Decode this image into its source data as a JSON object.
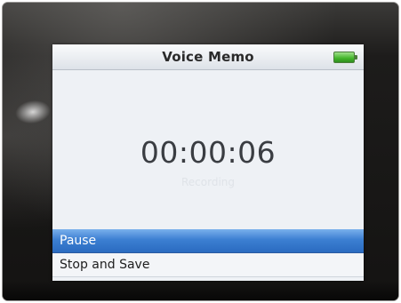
{
  "screen": {
    "title": "Voice Memo",
    "battery_icon": "battery-full-icon",
    "battery_color": "#43b52a",
    "timer": "00:00:06",
    "status": "Recording"
  },
  "menu": {
    "items": [
      {
        "label": "Pause",
        "selected": true
      },
      {
        "label": "Stop and Save",
        "selected": false
      }
    ],
    "selection_color": "#3c7fd2"
  }
}
